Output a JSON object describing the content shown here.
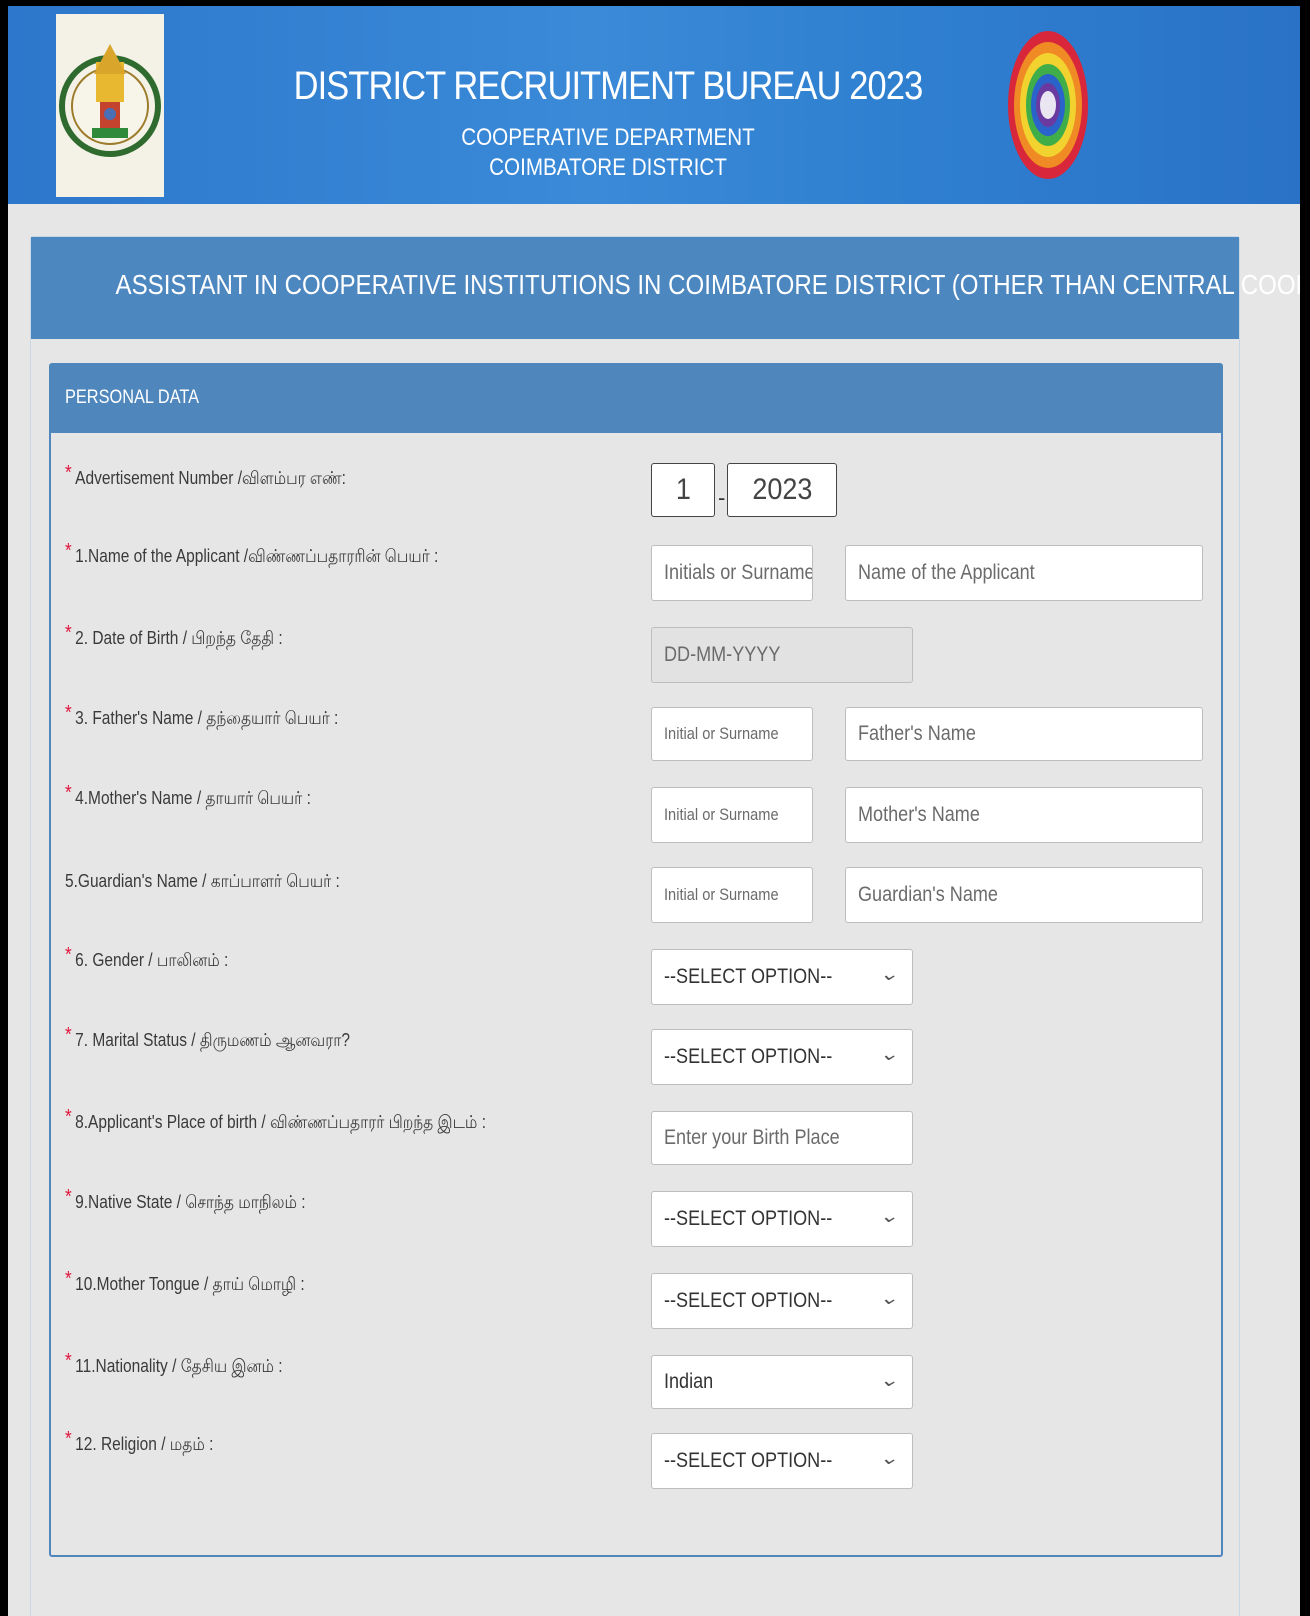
{
  "header": {
    "title": "DISTRICT RECRUITMENT BUREAU 2023",
    "subtitle_line1": "COOPERATIVE DEPARTMENT",
    "subtitle_line2": "COIMBATORE DISTRICT",
    "left_logo": "tamil-nadu-emblem",
    "right_logo": "rainbow-ring-logo"
  },
  "panel_title": "ASSISTANT IN COOPERATIVE INSTITUTIONS IN COIMBATORE DISTRICT (OTHER THAN CENTRAL COOPERATIVE BANK)",
  "section_title": "PERSONAL DATA",
  "colors": {
    "header_blue": "#2f7fd0",
    "panel_blue": "#4f87bd",
    "required_star": "#e0143c"
  },
  "required_mark": "*",
  "form": {
    "advertisement": {
      "label": "Advertisement Number /விளம்பர எண்:",
      "number": "1",
      "separator": "-",
      "year": "2023"
    },
    "applicant_name": {
      "label": "1.Name of the Applicant /விண்ணப்பதாரரின் பெயர் :",
      "initial_placeholder": "Initials or Surname",
      "name_placeholder": "Name of the Applicant"
    },
    "dob": {
      "label": "2. Date of Birth / பிறந்த தேதி :",
      "placeholder": "DD-MM-YYYY"
    },
    "father": {
      "label": "3. Father's Name / தந்தையார் பெயர் :",
      "initial_placeholder": "Initial or Surname",
      "name_placeholder": "Father's Name"
    },
    "mother": {
      "label": "4.Mother's Name / தாயார் பெயர் :",
      "initial_placeholder": "Initial or Surname",
      "name_placeholder": "Mother's Name"
    },
    "guardian": {
      "label": "5.Guardian's Name / காப்பாளர் பெயர் :",
      "initial_placeholder": "Initial or Surname",
      "name_placeholder": "Guardian's  Name"
    },
    "gender": {
      "label": "6. Gender / பாலினம் :",
      "value": "--SELECT OPTION--"
    },
    "marital": {
      "label": "7. Marital Status / திருமணம் ஆனவரா?",
      "value": "--SELECT OPTION--"
    },
    "birth_place": {
      "label": "8.Applicant's Place of birth / விண்ணப்பதாரர் பிறந்த இடம் :",
      "placeholder": "Enter your Birth Place"
    },
    "native_state": {
      "label": "9.Native State / சொந்த மாநிலம் :",
      "value": "--SELECT OPTION--"
    },
    "mother_tongue": {
      "label": "10.Mother Tongue / தாய் மொழி :",
      "value": "--SELECT OPTION--"
    },
    "nationality": {
      "label": "11.Nationality / தேசிய இனம் :",
      "value": "Indian"
    },
    "religion": {
      "label": "12. Religion / மதம் :",
      "value": "--SELECT OPTION--"
    }
  }
}
